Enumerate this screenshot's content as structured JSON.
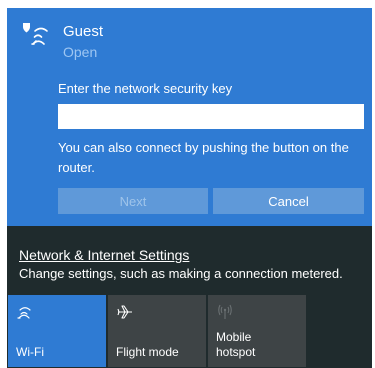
{
  "network": {
    "name": "Guest",
    "status": "Open",
    "key_label": "Enter the network security key",
    "key_value": "",
    "hint": "You can also connect by pushing the button on the router.",
    "next_label": "Next",
    "cancel_label": "Cancel",
    "icon": "wifi-secured-icon"
  },
  "settings": {
    "link": "Network & Internet Settings",
    "description": "Change settings, such as making a connection metered."
  },
  "quick_actions": [
    {
      "label": "Wi-Fi",
      "icon": "wifi-icon",
      "active": true
    },
    {
      "label": "Flight mode",
      "icon": "airplane-icon",
      "active": false
    },
    {
      "label": "Mobile hotspot",
      "icon": "hotspot-icon",
      "active": false,
      "disabled": true
    }
  ],
  "colors": {
    "accent": "#2f7bd3",
    "panel_bg": "#1f2b2d",
    "tile_bg": "#3e4446"
  }
}
